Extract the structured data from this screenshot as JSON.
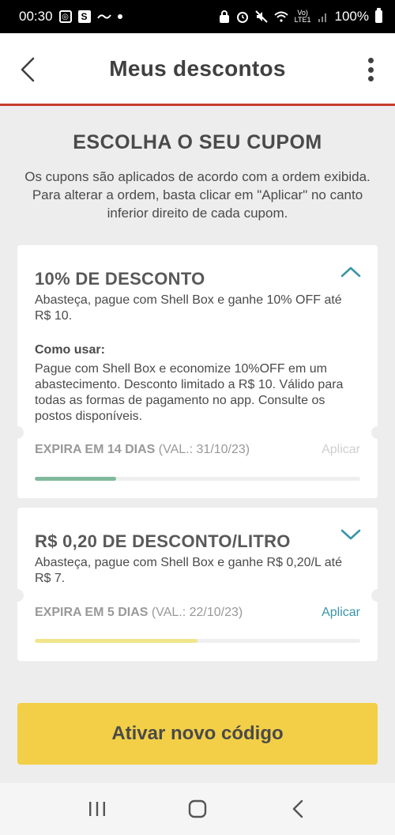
{
  "status_bar": {
    "time": "00:30",
    "volte": "Vo)",
    "lte": "LTE1",
    "battery": "100%"
  },
  "header": {
    "title": "Meus descontos"
  },
  "section": {
    "heading": "ESCOLHA O SEU CUPOM",
    "description": "Os cupons são aplicados de acordo com a ordem exibida. Para alterar a ordem, basta clicar em \"Aplicar\" no canto inferior direito de cada cupom."
  },
  "coupons": [
    {
      "title": "10% DE DESCONTO",
      "summary": "Abasteça, pague com Shell Box e ganhe 10% OFF até R$ 10.",
      "how_title": "Como usar:",
      "how_text": "Pague com Shell Box e economize 10%OFF em um abastecimento. Desconto limitado a R$ 10. Válido para todas as formas de pagamento no app. Consulte os postos disponíveis.",
      "expiry": "EXPIRA EM 14 DIAS",
      "validity": "(VAL.: 31/10/23)",
      "apply_label": "Aplicar",
      "progress": 0.25,
      "progress_color": "#7fb99b",
      "expanded": true
    },
    {
      "title": "R$ 0,20 DE DESCONTO/LITRO",
      "summary": "Abasteça, pague com Shell Box e ganhe R$ 0,20/L até R$ 7.",
      "expiry": "EXPIRA EM 5 DIAS",
      "validity": "(VAL.: 22/10/23)",
      "apply_label": "Aplicar",
      "progress": 0.5,
      "progress_color": "#f1e58c",
      "expanded": false
    }
  ],
  "cta": {
    "label": "Ativar novo código"
  },
  "colors": {
    "accent_red": "#c63c2c",
    "accent_teal": "#3a95a8",
    "cta_yellow": "#f2cf46"
  }
}
